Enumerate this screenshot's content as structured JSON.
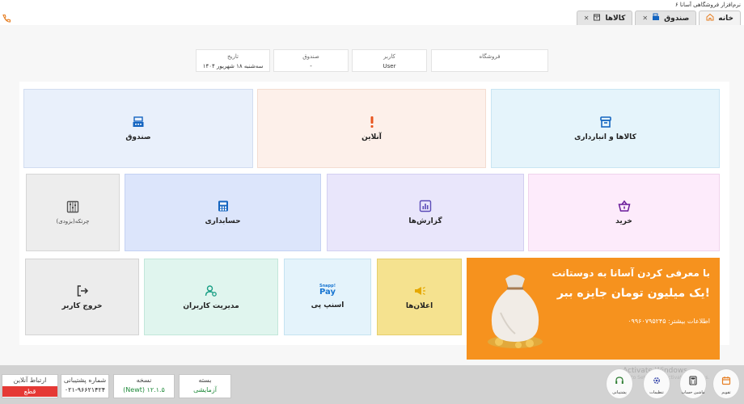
{
  "window": {
    "title": "نرم‌افزار فروشگاهی آسانا ۶"
  },
  "tabs": [
    {
      "label": "خانه",
      "icon": "home-icon",
      "closable": false,
      "active": true
    },
    {
      "label": "صندوق",
      "icon": "cash-register-icon",
      "closable": true,
      "active": false
    },
    {
      "label": "کالاها",
      "icon": "box-icon",
      "closable": true,
      "active": false
    }
  ],
  "info": {
    "store": {
      "label": "فروشگاه",
      "value": ""
    },
    "user": {
      "label": "کاربر",
      "value": "User"
    },
    "cashbox": {
      "label": "صندوق",
      "value": "-"
    },
    "date": {
      "label": "تاریخ",
      "value": "سه‌شنبه ۱۸ شهریور ۱۴۰۴"
    }
  },
  "tiles": {
    "goods": "کالاها و انبارداری",
    "online": "آنلاین",
    "cashbox": "صندوق",
    "purchase": "خرید",
    "reports": "گزارش‌ها",
    "accounting": "حسابداری",
    "cycle": "چرتکه(بزودی)",
    "announcements": "اعلان‌ها",
    "snappay": "اسنپ پی",
    "snappay_logo_top": "Snapp!",
    "snappay_logo_bottom": "Pay",
    "user_management": "مدیریت کاربران",
    "logout": "خروج کاربر"
  },
  "promo": {
    "line1": "با معرفی کردن آسانا به دوستانت",
    "line2": "یک میلیون تومان جایزه ببر!",
    "more": "اطلاعات بیشتر: ۰۹۹۶۰۷۹۵۲۴۵"
  },
  "status": {
    "package": {
      "label": "بسته",
      "value": "آزمایشی"
    },
    "version": {
      "label": "نسخه",
      "value": "(Newt) ۱۲.۱.۵"
    },
    "support": {
      "label": "شماره پشتیبانی",
      "value": "۰۲۱-۹۶۶۲۱۴۲۴"
    },
    "online": {
      "label": "ارتباط آنلاین",
      "value": "قطع"
    },
    "buttons": {
      "calendar": "تقویم",
      "calculator": "ماشین حساب",
      "settings": "تنظیمات",
      "support": "پشتیبانی"
    },
    "watermark": "Activate Windows",
    "watermark_sub": "Go to Settings to activate Windows."
  },
  "colors": {
    "accent_orange": "#f6921e",
    "blue_icon": "#1565c0",
    "offline_red": "#e53935"
  }
}
